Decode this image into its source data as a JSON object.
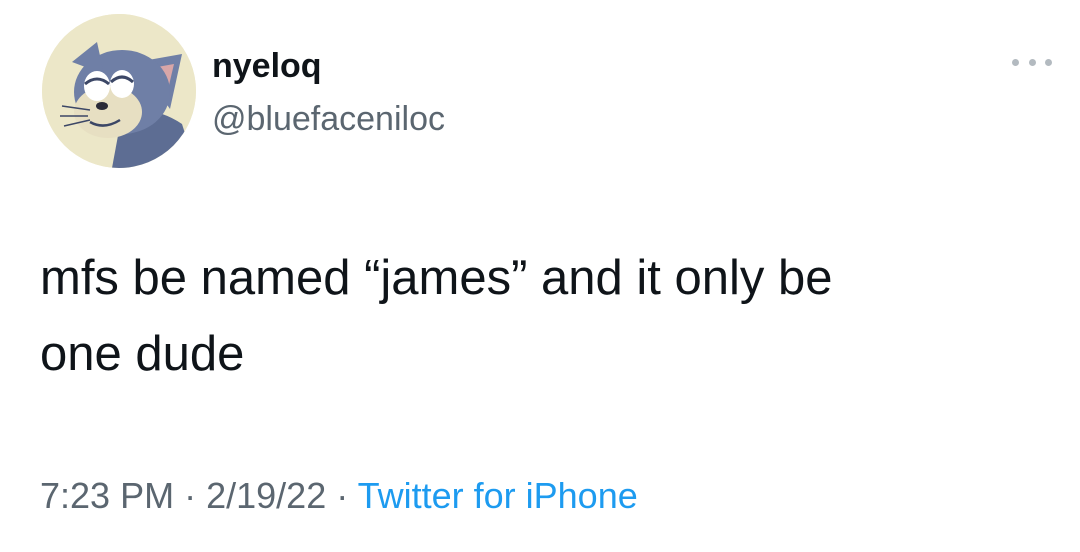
{
  "tweet": {
    "display_name": "nyeloq",
    "handle": "@bluefaceniloc",
    "avatar_icon": "cartoon-cat-avatar",
    "more_icon": "more-options-icon",
    "text": "mfs be named “james” and it only be\none dude",
    "time": "7:23 PM",
    "separator": "·",
    "date": "2/19/22",
    "source": "Twitter for iPhone",
    "colors": {
      "text": "#0f1419",
      "secondary": "#5b6670",
      "link": "#1d9bf0"
    }
  }
}
